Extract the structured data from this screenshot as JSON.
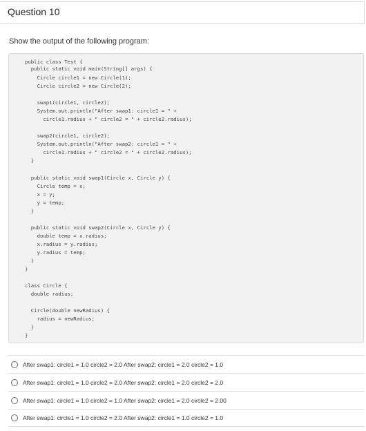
{
  "question": {
    "title": "Question 10",
    "prompt": "Show the output of the following program:"
  },
  "code_lines": [
    "public class Test {",
    "  public static void main(String[] args) {",
    "    Circle circle1 = new Circle(1);",
    "    Circle circle2 = new Circle(2);",
    "",
    "    swap1(circle1, circle2);",
    "    System.out.println(\"After swap1: circle1 = \" +",
    "      circle1.radius + \" circle2 = \" + circle2.radius);",
    "",
    "    swap2(circle1, circle2);",
    "    System.out.println(\"After swap2: circle1 = \" +",
    "      circle1.radius + \" circle2 = \" + circle2.radius);",
    "  }",
    "",
    "  public static void swap1(Circle x, Circle y) {",
    "    Circle temp = x;",
    "    x = y;",
    "    y = temp;",
    "  }",
    "",
    "  public static void swap2(Circle x, Circle y) {",
    "    double temp = x.radius;",
    "    x.radius = y.radius;",
    "    y.radius = temp;",
    "  }",
    "}",
    "",
    "class Circle {",
    "  double radius;",
    "",
    "  Circle(double newRadius) {",
    "    radius = newRadius;",
    "  }",
    "}"
  ],
  "options": [
    "After swap1: circle1 = 1.0 circle2 = 2.0 After swap2: circle1 = 2.0 circle2 = 1.0",
    "After swap1: circle1 = 1.0 circle2 = 2.0 After swap2: circle1 = 2.0 circle2 = 2.0",
    "After swap1: circle1 = 1.0 circle2 = 1.0 After swap2: circle1 = 2.0 circle2 = 2.00",
    "After swap1: circle1 = 1.0 circle2 = 2.0 After swap2: circle1 = 1.0 circle2 = 1.0"
  ]
}
